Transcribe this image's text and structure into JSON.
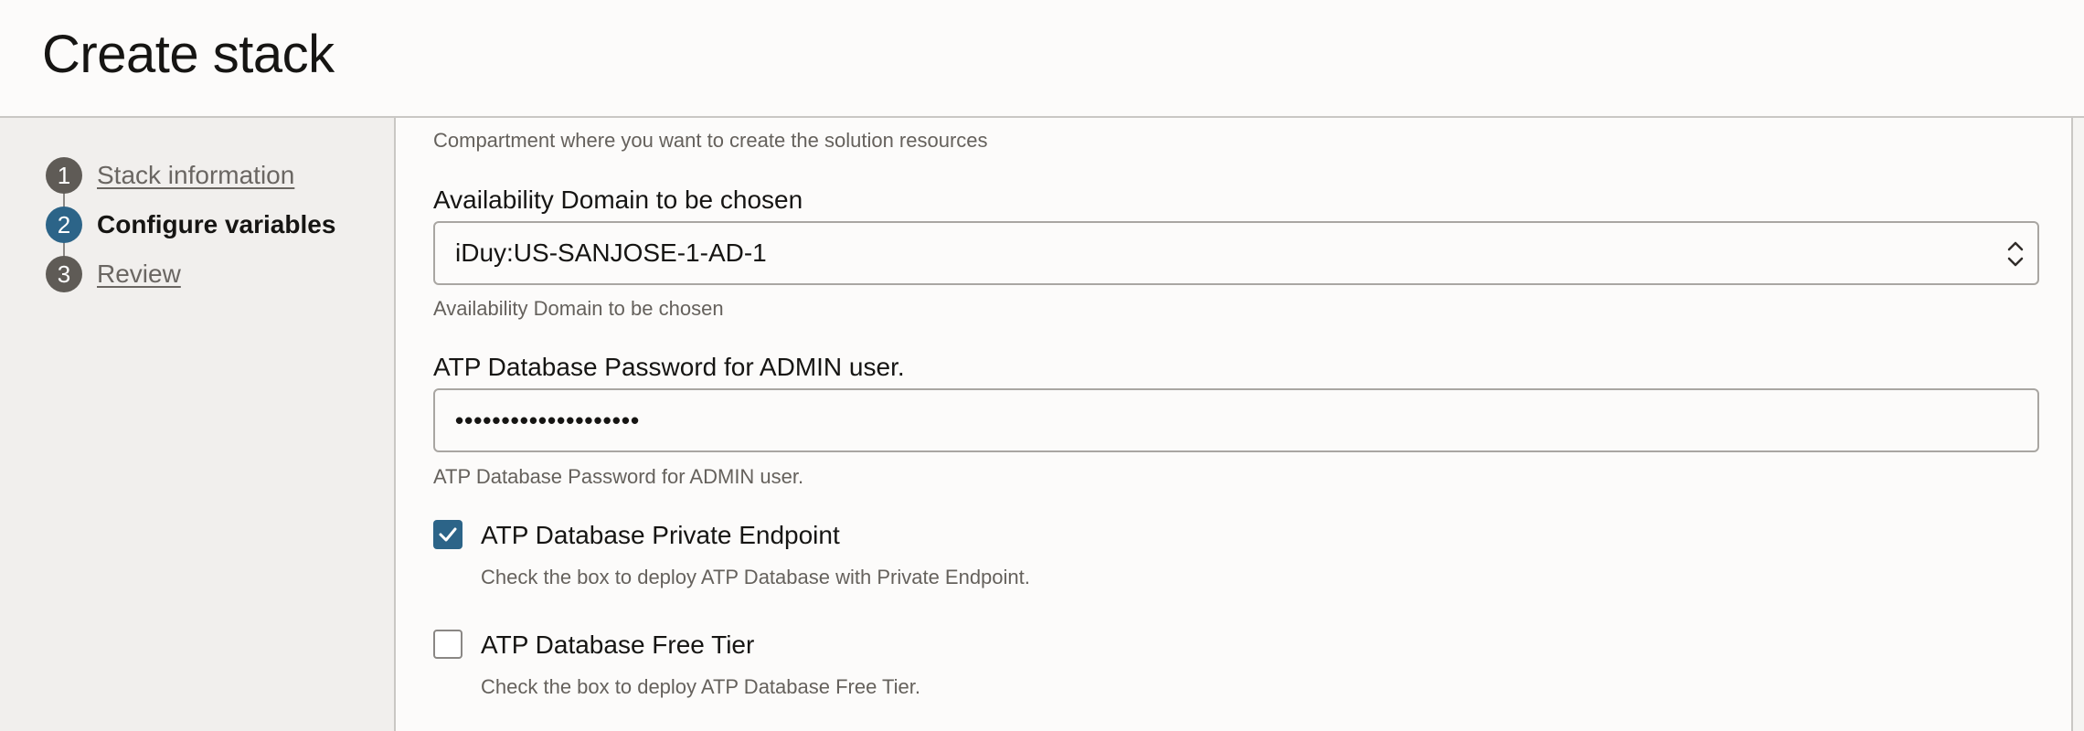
{
  "header": {
    "title": "Create stack"
  },
  "steps": [
    {
      "number": "1",
      "label": "Stack information"
    },
    {
      "number": "2",
      "label": "Configure variables"
    },
    {
      "number": "3",
      "label": "Review"
    }
  ],
  "form": {
    "compartment_help": "Compartment where you want to create the solution resources",
    "availability_domain": {
      "label": "Availability Domain to be chosen",
      "value": "iDuy:US-SANJOSE-1-AD-1",
      "help": "Availability Domain to be chosen"
    },
    "atp_password": {
      "label": "ATP Database Password for ADMIN user.",
      "value": "••••••••••••••••••••",
      "help": "ATP Database Password for ADMIN user."
    },
    "private_endpoint": {
      "label": "ATP Database Private Endpoint",
      "help": "Check the box to deploy ATP Database with Private Endpoint.",
      "checked": true
    },
    "free_tier": {
      "label": "ATP Database Free Tier",
      "help": "Check the box to deploy ATP Database Free Tier.",
      "checked": false
    }
  },
  "colors": {
    "accent": "#2c6488",
    "step_inactive": "#5f5b56",
    "text_primary": "#161513",
    "text_secondary": "#65615c"
  }
}
